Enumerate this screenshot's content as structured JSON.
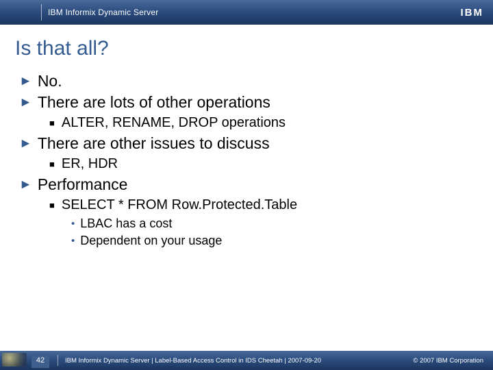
{
  "header": {
    "subtitle": "IBM Informix Dynamic Server",
    "logo_text": "IBM"
  },
  "title": "Is that all?",
  "bullets": {
    "b1": "No.",
    "b2": "There are lots of other operations",
    "b2_1": "ALTER, RENAME, DROP operations",
    "b3": "There are other issues to discuss",
    "b3_1": "ER, HDR",
    "b4": "Performance",
    "b4_1": "SELECT * FROM Row.Protected.Table",
    "b4_1a": "LBAC has a cost",
    "b4_1b": "Dependent on your usage"
  },
  "footer": {
    "page": "42",
    "text": "IBM Informix Dynamic Server  |  Label-Based Access Control in IDS Cheetah | 2007-09-20",
    "copyright": "© 2007 IBM Corporation"
  }
}
